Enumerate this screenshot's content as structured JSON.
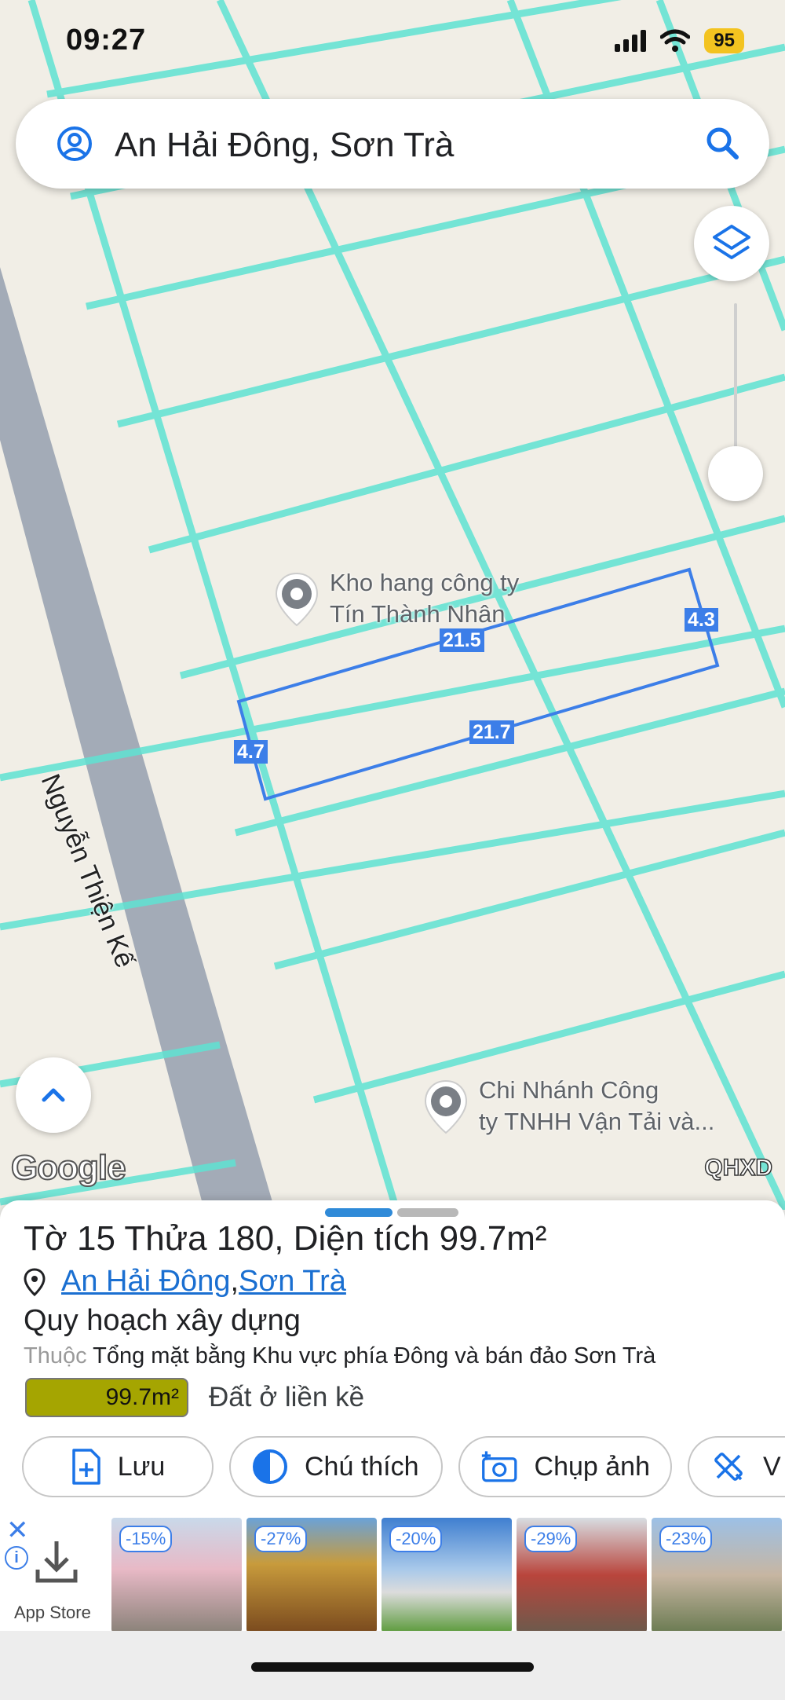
{
  "status_bar": {
    "time": "09:27",
    "battery": "95"
  },
  "search": {
    "query": "An Hải Đông, Sơn Trà"
  },
  "map": {
    "street_name": "Nguyễn Thiện Kế",
    "dimensions": {
      "top": "21.5",
      "bottom": "21.7",
      "left": "4.7",
      "right": "4.3"
    },
    "pois": [
      {
        "name": "Kho hang công ty\nTín Thành Nhân"
      },
      {
        "name": "Chi Nhánh Công\nty TNHH Vận Tải và..."
      }
    ],
    "attribution": "Google",
    "overlay_label": "QHXD",
    "colors": {
      "parcel_lines": "#5fe3d3",
      "road": "#a3abb7",
      "selection": "#3c7ee8",
      "background": "#f1eee6"
    }
  },
  "sheet": {
    "title": {
      "sheet_prefix": "Tờ ",
      "sheet_no": "15",
      "plot_prefix": " Thửa ",
      "plot_no": "180",
      "area_prefix": ", Diện tích ",
      "area": "99.7",
      "area_unit": "m²"
    },
    "location": {
      "ward": "An Hải Đông",
      "separator": ", ",
      "district": "Sơn Trà"
    },
    "plan_heading": "Quy hoạch xây dựng",
    "belongs_prefix": "Thuộc",
    "belongs_text": " Tổng mặt bằng Khu vực phía Đông và bán đảo Sơn Trà",
    "land_area": "99.7m²",
    "land_type": "Đất ở liền kề",
    "land_color": "#a5a501",
    "actions": [
      {
        "label": "Lưu",
        "icon": "file-add-icon"
      },
      {
        "label": "Chú thích",
        "icon": "contrast-icon"
      },
      {
        "label": "Chụp ảnh",
        "icon": "camera-add-icon"
      },
      {
        "label": "V",
        "icon": "ruler-pencil-icon"
      }
    ]
  },
  "ad": {
    "store_label": "App Store",
    "discounts": [
      "-15%",
      "-27%",
      "-20%",
      "-29%",
      "-23%"
    ]
  }
}
